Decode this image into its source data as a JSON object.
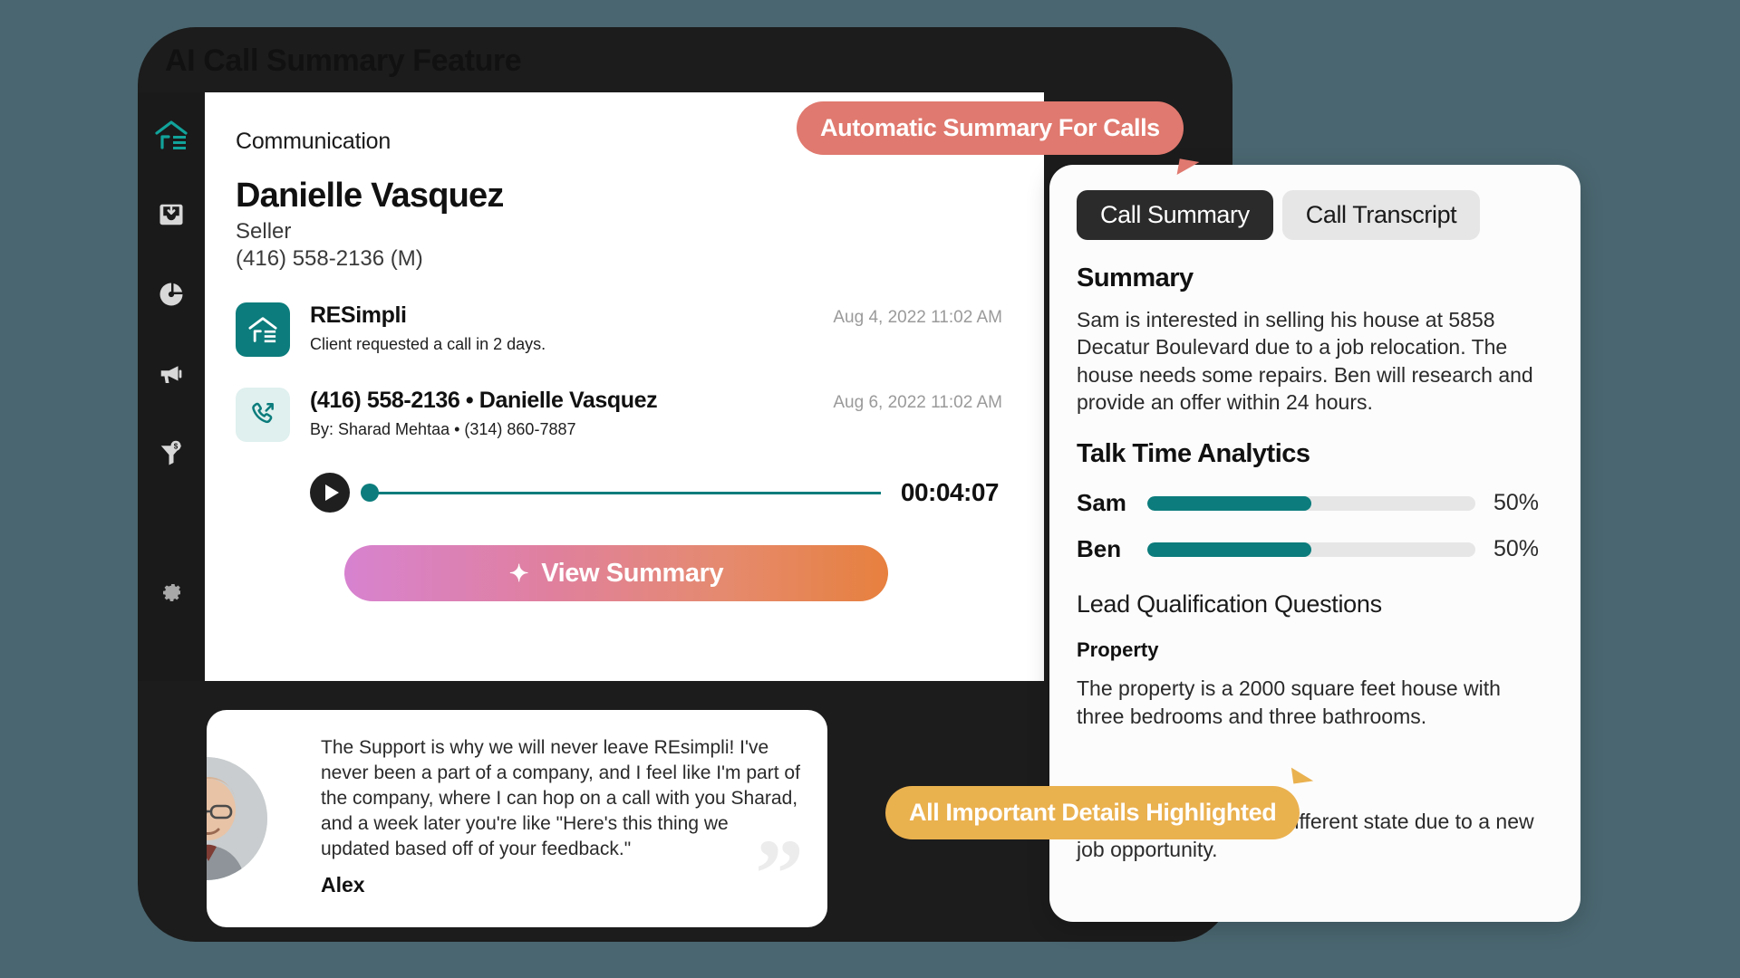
{
  "page": {
    "title": "AI Call Summary Feature",
    "accent_teal": "#0C7C7C",
    "badge_coral": "#E0796F",
    "badge_amber": "#EAB14F"
  },
  "sidebar": {
    "items": [
      {
        "icon": "resimpli-logo-icon",
        "label": "RESimpli"
      },
      {
        "icon": "inbox-download-icon",
        "label": "Leads"
      },
      {
        "icon": "donut-chart-icon",
        "label": "Analytics"
      },
      {
        "icon": "megaphone-icon",
        "label": "Marketing"
      },
      {
        "icon": "funnel-dollar-icon",
        "label": "Deals"
      },
      {
        "icon": "gear-icon",
        "label": "Settings"
      }
    ]
  },
  "communication": {
    "kicker": "Communication",
    "lead_name": "Danielle Vasquez",
    "lead_role": "Seller",
    "lead_phone": "(416) 558-2136  (M)",
    "messages": [
      {
        "icon": "resimpli-logo-icon",
        "title": "RESimpli",
        "subtitle": "Client requested a call in 2 days.",
        "timestamp": "Aug 4, 2022 11:02 AM"
      },
      {
        "icon": "outgoing-call-icon",
        "title": "(416) 558-2136 • Danielle Vasquez",
        "subtitle": "By: Sharad Mehtaa • (314) 860-7887",
        "timestamp": "Aug 6, 2022 11:02 AM"
      }
    ],
    "player": {
      "duration": "00:04:07",
      "progress_percent": 0
    },
    "view_summary_label": "View Summary",
    "view_summary_icon": "sparkle-icon"
  },
  "summary_panel": {
    "tabs": [
      {
        "label": "Call Summary",
        "active": true
      },
      {
        "label": "Call Transcript",
        "active": false
      }
    ],
    "summary_heading": "Summary",
    "summary_text": "Sam is interested in selling his house at 5858 Decatur Boulevard due to a job relocation. The house needs some repairs. Ben will research and provide an offer within 24 hours.",
    "talk_time_heading": "Talk Time Analytics",
    "talk_time": [
      {
        "name": "Sam",
        "percent_label": "50%",
        "percent": 50
      },
      {
        "name": "Ben",
        "percent_label": "50%",
        "percent": 50
      }
    ],
    "lead_qual_heading": "Lead Qualification Questions",
    "property_label": "Property",
    "property_text": "The property is a 2000 square feet house with three bedrooms and three bathrooms.",
    "relocation_text": "Sam is relocating to a different state due to a new job opportunity."
  },
  "badges": {
    "top": "Automatic Summary For Calls",
    "bottom": "All Important Details Highlighted"
  },
  "testimonial": {
    "quote": "The Support is why we will never leave REsimpli! I've never been a part of a company, and I feel like I'm part of the company, where I can hop on a call with you Sharad, and a week later you're like \"Here's this thing we updated based off of your feedback.\"",
    "author": "Alex",
    "quote_mark": "”"
  }
}
